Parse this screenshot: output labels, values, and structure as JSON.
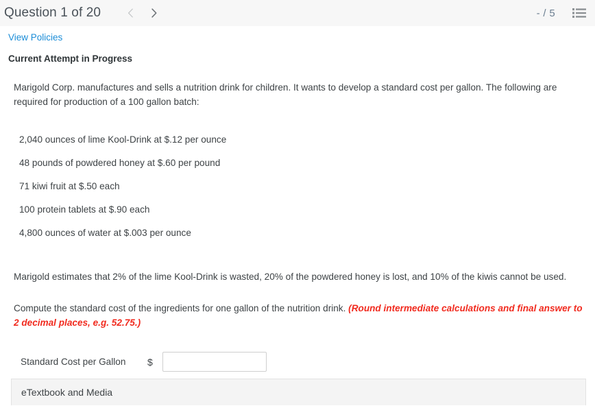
{
  "header": {
    "title": "Question 1 of 20",
    "prev_icon": "chevron-left-icon",
    "next_icon": "chevron-right-icon",
    "score": "- / 5",
    "list_icon": "numbered-list-icon"
  },
  "links": {
    "view_policies": "View Policies"
  },
  "status": {
    "attempt": "Current Attempt in Progress"
  },
  "question": {
    "intro": "Marigold Corp. manufactures and sells a nutrition drink for children. It wants to develop a standard cost per gallon. The following are required for production of a 100 gallon batch:",
    "ingredients": [
      "2,040 ounces of lime Kool-Drink at $.12 per ounce",
      "48 pounds of powdered honey at $.60 per pound",
      "71 kiwi fruit at $.50 each",
      "100 protein tablets at $.90 each",
      "4,800 ounces of water at $.003 per ounce"
    ],
    "estimates": "Marigold estimates that 2% of the lime Kool-Drink is wasted, 20% of the powdered honey is lost, and 10% of the kiwis cannot be used.",
    "compute": "Compute the standard cost of the ingredients for one gallon of the nutrition drink. ",
    "hint": "(Round intermediate calculations and final answer to 2 decimal places, e.g. 52.75.)"
  },
  "answer": {
    "label": "Standard Cost per Gallon",
    "currency": "$",
    "value": "",
    "placeholder": ""
  },
  "footer": {
    "etextbook": "eTextbook and Media"
  },
  "colors": {
    "link": "#1a8cd7",
    "hint": "#f12b1f",
    "header_bg": "#f7f7f7",
    "text": "#3e4346",
    "score": "#6b7e90"
  }
}
